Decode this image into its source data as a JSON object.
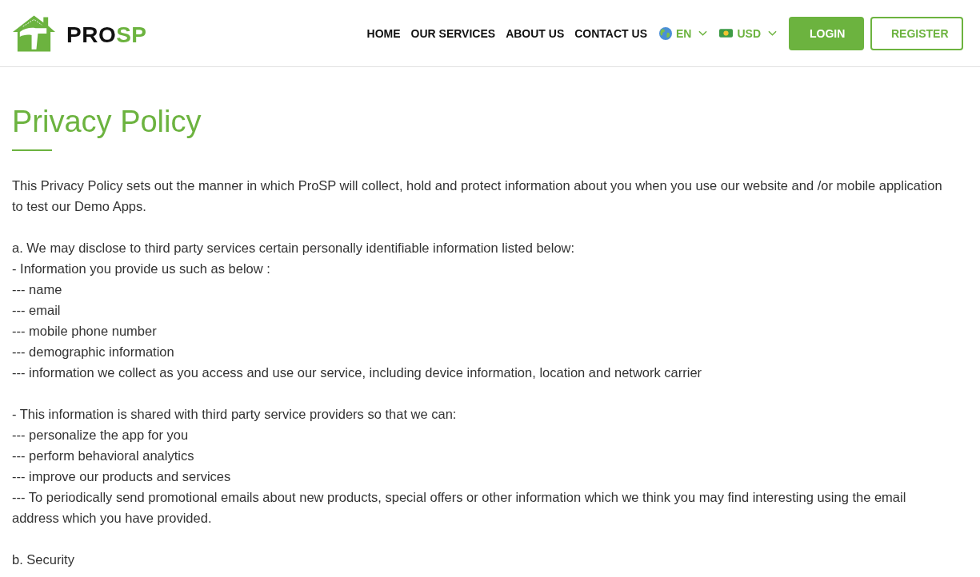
{
  "header": {
    "logo": [
      {
        "text": "PRO",
        "kind": "dark"
      },
      {
        "text": "SP",
        "kind": "accent"
      }
    ],
    "nav": [
      {
        "label": "HOME"
      },
      {
        "label": "OUR SERVICES"
      },
      {
        "label": "ABOUT US"
      },
      {
        "label": "CONTACT US"
      }
    ],
    "language": {
      "label": "EN"
    },
    "currency": {
      "label": "USD"
    },
    "login_button": {
      "label": "LOGIN"
    },
    "register_button": {
      "label": "REGISTER"
    }
  },
  "page": {
    "title": "Privacy Policy",
    "blocks": [
      {
        "lines": [
          "This Privacy Policy sets out the manner in which ProSP will collect, hold and protect information about you when you use our website and /or mobile application to test our Demo Apps."
        ]
      },
      {
        "lines": [
          "a. We may disclose to third party services certain personally identifiable information listed below:",
          "- Information you provide us such as below :",
          "--- name",
          "--- email",
          "--- mobile phone number",
          "--- demographic information",
          "--- information we collect as you access and use our service, including device information, location and network carrier"
        ]
      },
      {
        "lines": [
          "- This information is shared with third party service providers so that we can:",
          "--- personalize the app for you",
          "--- perform behavioral analytics",
          "--- improve our products and services",
          "--- To periodically send promotional emails about new products, special offers or other information which we think you may find interesting using the email address which you have provided."
        ]
      },
      {
        "lines": [
          "b. Security"
        ]
      }
    ]
  }
}
